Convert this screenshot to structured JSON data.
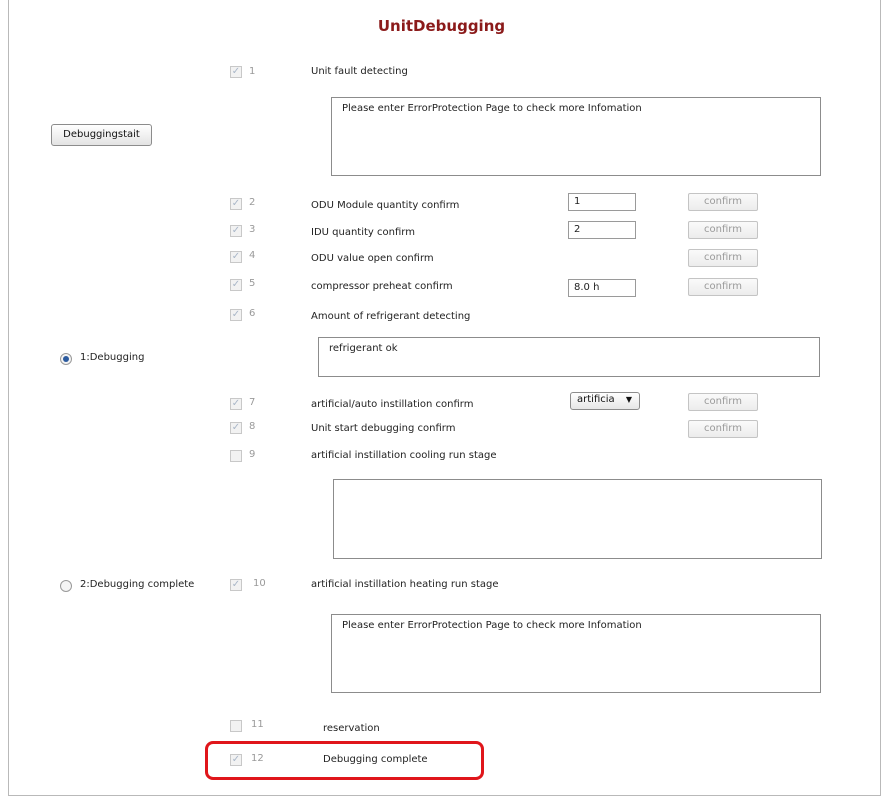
{
  "title": "UnitDebugging",
  "start_button": "Debuggingstait",
  "stages": [
    {
      "label": "1:Debugging",
      "selected": true
    },
    {
      "label": "2:Debugging complete",
      "selected": false
    }
  ],
  "steps": [
    {
      "num": "1",
      "label": "Unit fault detecting",
      "checked": true
    },
    {
      "num": "2",
      "label": "ODU Module quantity confirm",
      "checked": true,
      "value": "1",
      "button": "confirm"
    },
    {
      "num": "3",
      "label": "IDU quantity confirm",
      "checked": true,
      "value": "2",
      "button": "confirm"
    },
    {
      "num": "4",
      "label": "ODU value open confirm",
      "checked": true,
      "button": "confirm"
    },
    {
      "num": "5",
      "label": "compressor preheat confirm",
      "checked": true,
      "value": "8.0 h",
      "button": "confirm"
    },
    {
      "num": "6",
      "label": "Amount of refrigerant detecting",
      "checked": true
    },
    {
      "num": "7",
      "label": "artificial/auto instillation confirm",
      "checked": true,
      "select": "artificia",
      "button": "confirm"
    },
    {
      "num": "8",
      "label": "Unit start debugging confirm",
      "checked": true,
      "button": "confirm"
    },
    {
      "num": "9",
      "label": "artificial instillation cooling run stage",
      "checked": false
    },
    {
      "num": "10",
      "label": "artificial instillation heating run stage",
      "checked": true
    },
    {
      "num": "11",
      "label": "reservation",
      "checked": false
    },
    {
      "num": "12",
      "label": "Debugging complete",
      "checked": true
    }
  ],
  "messages": {
    "fault": "Please enter ErrorProtection Page to check more Infomation",
    "refrigerant": "refrigerant ok",
    "cooling": "",
    "heating": "Please enter ErrorProtection Page to check more Infomation"
  },
  "colors": {
    "title": "#8b1a1a",
    "highlight": "#e0161b"
  }
}
